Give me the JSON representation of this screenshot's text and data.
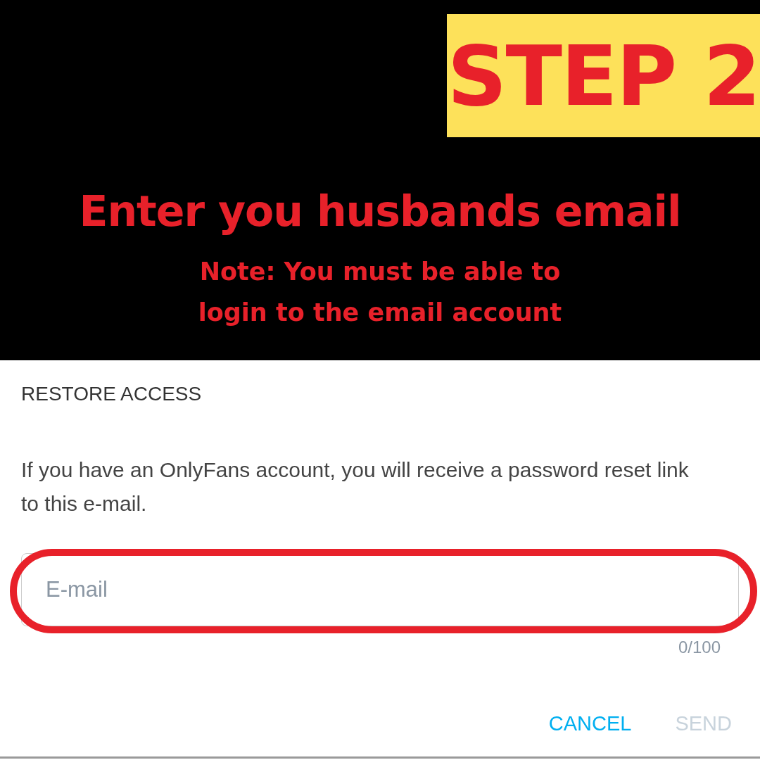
{
  "banner": {
    "step_badge": "STEP 2",
    "headline": "Enter you husbands email",
    "note_lines": [
      "Note: You must be able to",
      "login to the email account"
    ]
  },
  "dialog": {
    "title": "RESTORE ACCESS",
    "message": "If you have an OnlyFans account, you will receive a password reset link to this e-mail.",
    "email_field": {
      "placeholder": "E-mail",
      "highlighted": true
    },
    "counter": "0/100",
    "buttons": [
      {
        "label": "CANCEL",
        "disabled": false
      },
      {
        "label": "SEND",
        "disabled": true
      }
    ]
  }
}
